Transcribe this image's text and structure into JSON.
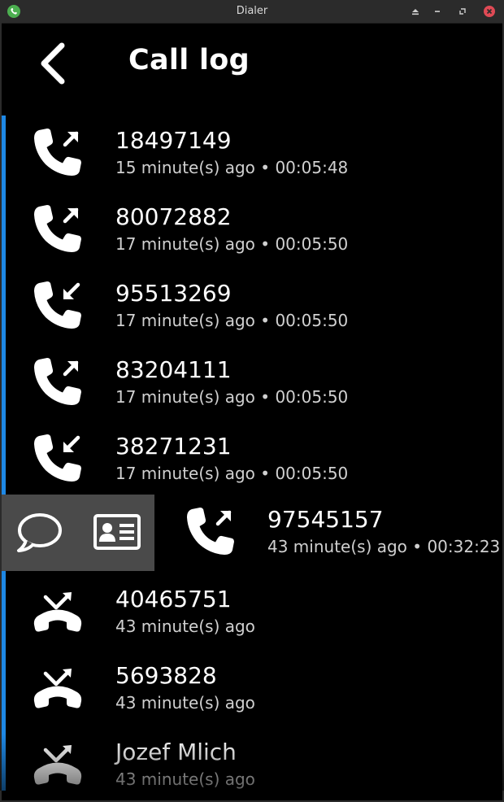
{
  "window": {
    "title": "Dialer"
  },
  "header": {
    "title": "Call log"
  },
  "colors": {
    "accent": "#1e88e5",
    "swipe_bg": "#4a4a4a",
    "close": "#e04a55",
    "app_icon": "#4caf50"
  },
  "calls": [
    {
      "number": "18497149",
      "time": "15 minute(s) ago",
      "duration": "00:05:48",
      "type": "outgoing"
    },
    {
      "number": "80072882",
      "time": "17 minute(s) ago",
      "duration": "00:05:50",
      "type": "outgoing"
    },
    {
      "number": "95513269",
      "time": "17 minute(s) ago",
      "duration": "00:05:50",
      "type": "incoming"
    },
    {
      "number": "83204111",
      "time": "17 minute(s) ago",
      "duration": "00:05:50",
      "type": "outgoing"
    },
    {
      "number": "38271231",
      "time": "17 minute(s) ago",
      "duration": "00:05:50",
      "type": "incoming"
    },
    {
      "number": "97545157",
      "time": "43 minute(s) ago",
      "duration": "00:32:23",
      "type": "outgoing"
    },
    {
      "number": "40465751",
      "time": "43 minute(s) ago",
      "duration": "",
      "type": "missed"
    },
    {
      "number": "5693828",
      "time": "43 minute(s) ago",
      "duration": "",
      "type": "missed"
    },
    {
      "number": "Jozef Mlich",
      "time": "43 minute(s) ago",
      "duration": "",
      "type": "missed"
    }
  ],
  "swipe_actions": [
    {
      "icon": "message-icon"
    },
    {
      "icon": "contact-card-icon"
    }
  ]
}
